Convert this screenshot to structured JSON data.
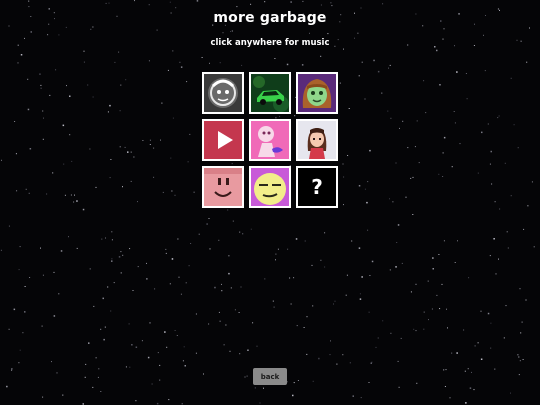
{
  "header": {
    "title": "more garbage",
    "subtitle": "click anywhere for music"
  },
  "grid": {
    "tiles": [
      {
        "name": "glowing-face-portrait-icon"
      },
      {
        "name": "green-car-icon"
      },
      {
        "name": "brown-haired-girl-portrait-icon"
      },
      {
        "name": "red-play-icon"
      },
      {
        "name": "pink-character-icon"
      },
      {
        "name": "pixel-girl-portrait-icon"
      },
      {
        "name": "pink-blob-face-icon"
      },
      {
        "name": "yellow-smug-face-icon"
      },
      {
        "name": "mystery-question-icon",
        "label": "?"
      }
    ]
  },
  "footer": {
    "back_label": "back"
  },
  "colors": {
    "background": "#050507",
    "text": "#ffffff",
    "button": "#8a8a8a",
    "tile_border": "#ffffff"
  }
}
